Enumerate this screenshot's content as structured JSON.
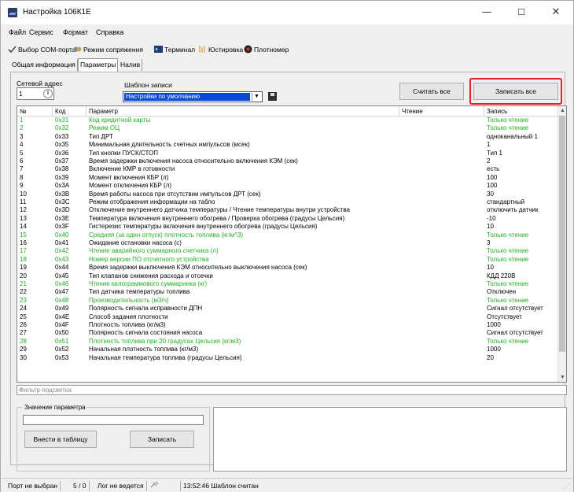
{
  "window": {
    "title": "Настройка 106К1Е",
    "controls": {
      "minimize": "—",
      "maximize": "☐",
      "close": "✕"
    }
  },
  "menu": [
    "Файл",
    "Сервис",
    "Формат",
    "Справка"
  ],
  "toolbar": [
    {
      "label": "Выбор COM-порта",
      "icon": "checkmark-icon"
    },
    {
      "label": "Режим сопряжения",
      "icon": "handshake-icon"
    },
    {
      "label": "Терминал",
      "icon": "terminal-icon"
    },
    {
      "label": "Юстировка",
      "icon": "calibration-icon"
    },
    {
      "label": "Плотномер",
      "icon": "densitometer-icon"
    }
  ],
  "tabs": [
    {
      "label": "Общая информация",
      "active": false
    },
    {
      "label": "Параметры",
      "active": true
    },
    {
      "label": "Налив",
      "active": false
    }
  ],
  "controls": {
    "net_address_label": "Сетевой адрес",
    "net_address_value": "1",
    "template_label": "Шаблон записи",
    "template_value": "Настройки по умолчанию",
    "read_all": "Считать все",
    "write_all": "Записать все"
  },
  "colors": {
    "readonly_text": "#1fb31f",
    "highlight": "#e0212c",
    "selection": "#0a4ad6"
  },
  "table": {
    "headers": {
      "n": "№",
      "code": "Код",
      "param": "Параметр",
      "read": "Чтение",
      "write": "Запись"
    },
    "rows": [
      {
        "n": "1",
        "code": "0x31",
        "param": "Код кредитной карты",
        "write": "Только чтение",
        "ro": true
      },
      {
        "n": "2",
        "code": "0x32",
        "param": "Режим ОЦ",
        "write": "Только чтение",
        "ro": true
      },
      {
        "n": "3",
        "code": "0x33",
        "param": "Тип ДРТ",
        "write": "одноканальный 1",
        "ro": false
      },
      {
        "n": "4",
        "code": "0x35",
        "param": "Минимальная длительность счетных импульсов (мсек)",
        "write": "1",
        "ro": false
      },
      {
        "n": "5",
        "code": "0x36",
        "param": "Тип кнопки ПУСК/СТОП",
        "write": "Тип 1",
        "ro": false
      },
      {
        "n": "6",
        "code": "0x37",
        "param": "Время задержки включения насоса относительно включения КЭМ (сек)",
        "write": "2",
        "ro": false
      },
      {
        "n": "7",
        "code": "0x38",
        "param": "Включение КМР в готовности",
        "write": "есть",
        "ro": false
      },
      {
        "n": "8",
        "code": "0x39",
        "param": "Момент включения КБР (л)",
        "write": "100",
        "ro": false
      },
      {
        "n": "9",
        "code": "0x3A",
        "param": "Момент отключения КБР (л)",
        "write": "100",
        "ro": false
      },
      {
        "n": "10",
        "code": "0x3B",
        "param": "Время работы насоса при отсутствии импульсов ДРТ (сек)",
        "write": "30",
        "ro": false
      },
      {
        "n": "11",
        "code": "0x3C",
        "param": "Режим отображения информации на табло",
        "write": "стандартный",
        "ro": false
      },
      {
        "n": "12",
        "code": "0x3D",
        "param": "Отключение внутреннего датчика температуры / Чтение температуры внутри устройства",
        "write": "отключить датчик",
        "ro": false
      },
      {
        "n": "13",
        "code": "0x3E",
        "param": "Температура включения внутреннего обогрева / Проверка обогрева (градусы Цельсия)",
        "write": "-10",
        "ro": false
      },
      {
        "n": "14",
        "code": "0x3F",
        "param": "Гистерезис температуры включения внутреннего обогрева (градусы Цельсия)",
        "write": "10",
        "ro": false
      },
      {
        "n": "15",
        "code": "0x40",
        "param": "Средняя (за один отпуск) плотность топлива (кг/м^3)",
        "write": "Только чтение",
        "ro": true
      },
      {
        "n": "16",
        "code": "0x41",
        "param": "Ожидание остановки насоса (с)",
        "write": "3",
        "ro": false
      },
      {
        "n": "17",
        "code": "0x42",
        "param": "Чтение аварийного суммарного счетчика (л)",
        "write": "Только чтение",
        "ro": true
      },
      {
        "n": "18",
        "code": "0x43",
        "param": "Номер версии ПО отсчетного устройства",
        "write": "Только чтение",
        "ro": true
      },
      {
        "n": "19",
        "code": "0x44",
        "param": "Время задержки выключения КЭМ относительно выключения насоса (сек)",
        "write": "10",
        "ro": false
      },
      {
        "n": "20",
        "code": "0x45",
        "param": "Тип клапанов снижения расхода и отсечки",
        "write": "КДД 220В",
        "ro": false
      },
      {
        "n": "21",
        "code": "0x46",
        "param": "Чтение килограммового суммарника (кг)",
        "write": "Только чтение",
        "ro": true
      },
      {
        "n": "22",
        "code": "0x47",
        "param": "Тип датчика температуры топлива",
        "write": "Отключен",
        "ro": false
      },
      {
        "n": "23",
        "code": "0x48",
        "param": "Производительность (м3/ч)",
        "write": "Только чтение",
        "ro": true
      },
      {
        "n": "24",
        "code": "0x49",
        "param": "Полярность сигнала исправности ДПН",
        "write": "Сигнал отсутствует",
        "ro": false
      },
      {
        "n": "25",
        "code": "0x4E",
        "param": "Способ задания плотности",
        "write": "Отсутствует",
        "ro": false
      },
      {
        "n": "26",
        "code": "0x4F",
        "param": "Плотность топлива (кг/м3)",
        "write": "1000",
        "ro": false
      },
      {
        "n": "27",
        "code": "0x50",
        "param": "Полярность сигнала состояния насоса",
        "write": "Сигнал отсутствует",
        "ro": false
      },
      {
        "n": "28",
        "code": "0x51",
        "param": "Плотность топлива при 20 градусах Цельсия (кг/м3)",
        "write": "Только чтение",
        "ro": true
      },
      {
        "n": "29",
        "code": "0x52",
        "param": "Начальная плотность топлива (кг/м3)",
        "write": "1000",
        "ro": false
      },
      {
        "n": "30",
        "code": "0x53",
        "param": "Начальная температура топлива (градусы Цельсия)",
        "write": "20",
        "ro": false
      }
    ]
  },
  "filter": {
    "placeholder": "Фильтр-подсветка"
  },
  "param_group": {
    "title": "Значение параметра",
    "enter_table": "Внести в таблицу",
    "write": "Записать"
  },
  "status": {
    "port": "Порт не выбран",
    "counter": "5 / 0",
    "log": "Лог не ведется",
    "message": "13:52:46 Шаблон считан"
  }
}
